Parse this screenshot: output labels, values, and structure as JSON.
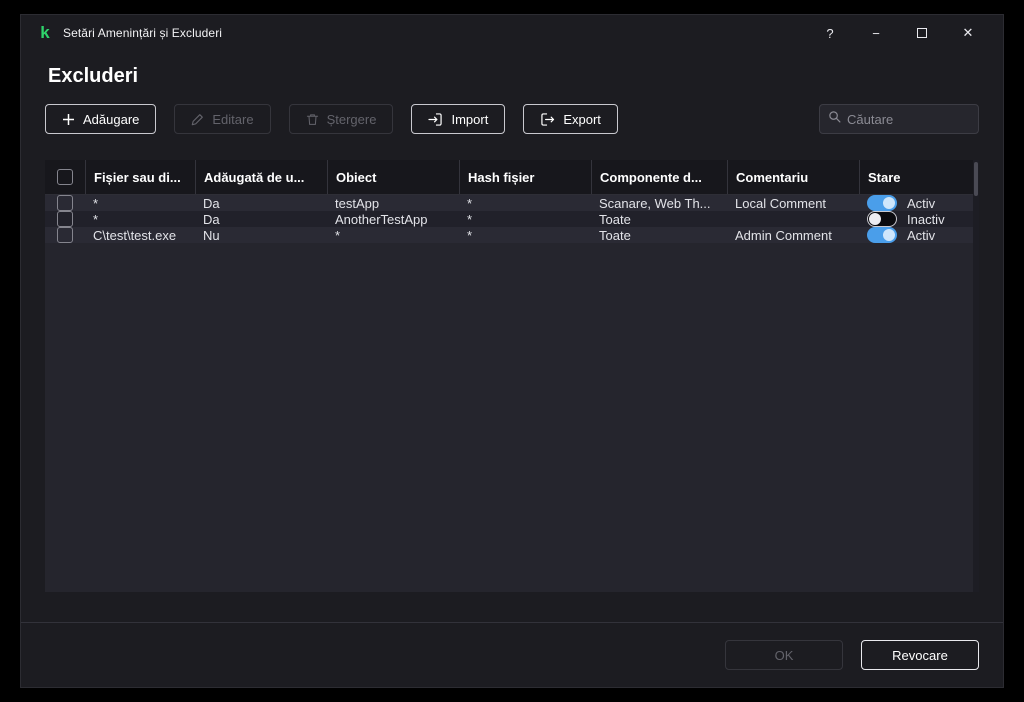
{
  "colors": {
    "accent_blue": "#4a9eea",
    "logo_green": "#2fd36b",
    "window_bg": "#1c1c21"
  },
  "titlebar": {
    "title": "Setări Amenințări și Excluderi",
    "help_icon": "?",
    "minimize_icon": "−",
    "close_icon": "✕"
  },
  "page": {
    "title": "Excluderi"
  },
  "toolbar": {
    "add_label": "Adăugare",
    "edit_label": "Editare",
    "delete_label": "Ștergere",
    "import_label": "Import",
    "export_label": "Export",
    "search_placeholder": "Căutare"
  },
  "table": {
    "columns": [
      "Fișier sau di...",
      "Adăugată de u...",
      "Obiect",
      "Hash fișier",
      "Componente d...",
      "Comentariu",
      "Stare"
    ],
    "rows": [
      {
        "file": "*",
        "added_by_user": "Da",
        "object": "testApp",
        "hash": "*",
        "components": "Scanare, Web Th...",
        "comment": "Local Comment",
        "state": "Activ",
        "active": true
      },
      {
        "file": "*",
        "added_by_user": "Da",
        "object": "AnotherTestApp",
        "hash": "*",
        "components": "Toate",
        "comment": "",
        "state": "Inactiv",
        "active": false
      },
      {
        "file": "C\\test\\test.exe",
        "added_by_user": "Nu",
        "object": "*",
        "hash": "*",
        "components": "Toate",
        "comment": "Admin Comment",
        "state": "Activ",
        "active": true
      }
    ]
  },
  "footer": {
    "ok_label": "OK",
    "cancel_label": "Revocare"
  }
}
